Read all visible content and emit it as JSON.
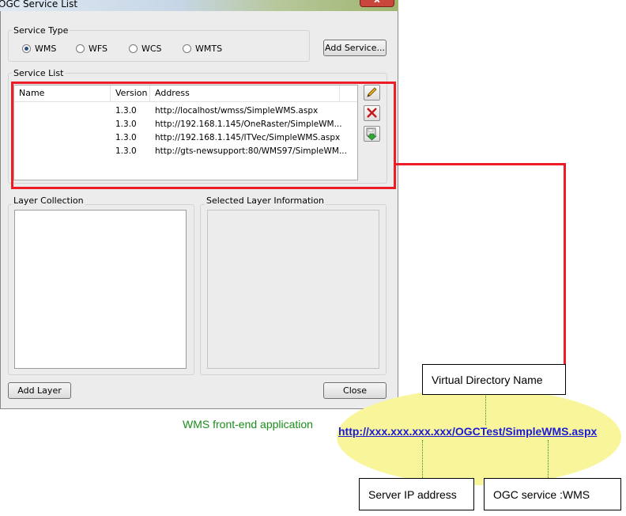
{
  "window": {
    "title": "OGC Service List",
    "close_glyph": "x"
  },
  "service_type": {
    "legend": "Service Type",
    "options": [
      {
        "label": "WMS",
        "selected": true
      },
      {
        "label": "WFS",
        "selected": false
      },
      {
        "label": "WCS",
        "selected": false
      },
      {
        "label": "WMTS",
        "selected": false
      }
    ],
    "add_button": "Add Service..."
  },
  "service_list": {
    "legend": "Service List",
    "columns": [
      "Name",
      "Version",
      "Address"
    ],
    "rows": [
      {
        "name": "",
        "version": "1.3.0",
        "address": "http://localhost/wmss/SimpleWMS.aspx"
      },
      {
        "name": "",
        "version": "1.3.0",
        "address": "http://192.168.1.145/OneRaster/SimpleWM..."
      },
      {
        "name": "",
        "version": "1.3.0",
        "address": "http://192.168.1.145/ITVec/SimpleWMS.aspx"
      },
      {
        "name": "",
        "version": "1.3.0",
        "address": "http://gts-newsupport:80/WMS97/SimpleWM..."
      }
    ],
    "side_buttons": [
      "pencil-icon",
      "delete-x-icon",
      "save-download-icon"
    ]
  },
  "layer_collection": {
    "legend": "Layer Collection"
  },
  "selected_layer": {
    "legend": "Selected Layer Information"
  },
  "buttons": {
    "add_layer": "Add Layer",
    "close": "Close"
  },
  "annotation": {
    "caption": "WMS front-end application",
    "url": "http://xxx.xxx.xxx.xxx/OGCTest/SimpleWMS.aspx",
    "virtual_directory": "Virtual Directory Name",
    "server_ip": "Server IP address",
    "ogc_service": "OGC service :WMS",
    "highlight_color": "#ee1c24",
    "ellipse_color": "#f9f59a",
    "caption_color": "#1a8d1a",
    "url_color": "#1b1bd6"
  }
}
